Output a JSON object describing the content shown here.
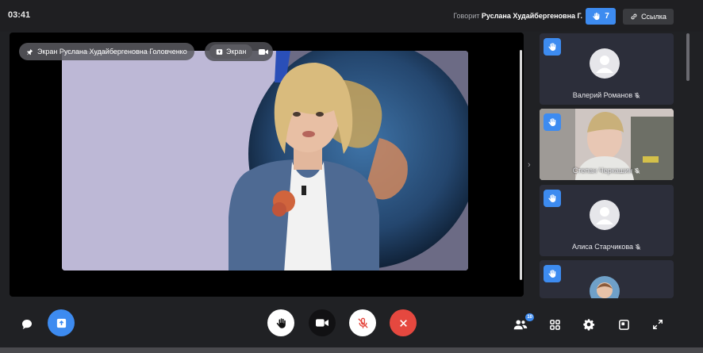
{
  "header": {
    "timer": "03:41",
    "speaker_prefix": "Говорит",
    "speaker_name": "Руслана Худайбергеновна Г.",
    "raised_hands_count": "7",
    "link_label": "Ссылка"
  },
  "stage": {
    "pin_label": "Экран Руслана Худайбергеновна Головченко",
    "screen_chip_label": "Экран"
  },
  "participants": [
    {
      "name": "Валерий Романов",
      "type": "avatar",
      "hand_raised": true,
      "muted": true
    },
    {
      "name": "Степан Черкашин",
      "type": "video",
      "hand_raised": true,
      "muted": true
    },
    {
      "name": "Алиса Старчикова",
      "type": "avatar",
      "hand_raised": true,
      "muted": true
    },
    {
      "name": "",
      "type": "avatar-photo",
      "hand_raised": true,
      "muted": false
    }
  ],
  "controls": {
    "participants_badge": "10",
    "icons": [
      "chat-icon",
      "share-screen-icon",
      "raise-hand-icon",
      "camera-icon",
      "microphone-muted-icon",
      "end-call-icon",
      "participants-icon",
      "grid-icon",
      "settings-icon",
      "layout-icon",
      "fullscreen-icon"
    ]
  },
  "colors": {
    "accent": "#3d8bf0",
    "end_call": "#e5483f",
    "background": "#202124"
  }
}
